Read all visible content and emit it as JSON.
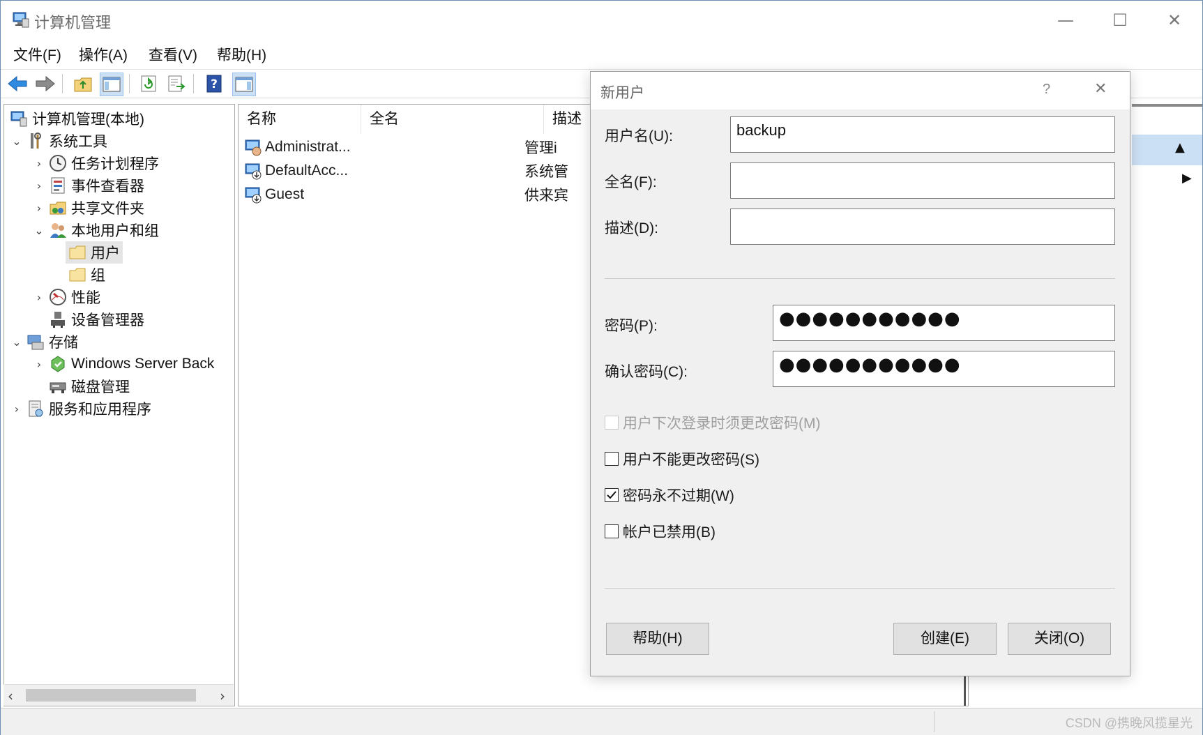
{
  "window": {
    "title": "计算机管理",
    "controls": {
      "minimize": "—",
      "maximize": "☐",
      "close": "✕"
    }
  },
  "menu": [
    "文件(F)",
    "操作(A)",
    "查看(V)",
    "帮助(H)"
  ],
  "toolbar": {
    "buttons": [
      "back-icon",
      "forward-icon",
      "up-folder-icon",
      "show-hide-tree-icon",
      "refresh-icon",
      "export-list-icon",
      "help-icon",
      "properties-pane-icon"
    ]
  },
  "tree": {
    "items": [
      {
        "label": "计算机管理(本地)",
        "icon": "computer-management-icon"
      },
      {
        "label": "系统工具",
        "arrow": "⌄",
        "icon": "tools-icon"
      },
      {
        "label": "任务计划程序",
        "arrow": "›",
        "icon": "clock-icon"
      },
      {
        "label": "事件查看器",
        "arrow": "›",
        "icon": "event-viewer-icon"
      },
      {
        "label": "共享文件夹",
        "arrow": "›",
        "icon": "shared-folder-icon"
      },
      {
        "label": "本地用户和组",
        "arrow": "⌄",
        "icon": "users-groups-icon"
      },
      {
        "label": "用户",
        "icon": "folder-icon"
      },
      {
        "label": "组",
        "icon": "folder-icon"
      },
      {
        "label": "性能",
        "arrow": "›",
        "icon": "performance-icon"
      },
      {
        "label": "设备管理器",
        "icon": "device-manager-icon"
      },
      {
        "label": "存储",
        "arrow": "⌄",
        "icon": "storage-icon"
      },
      {
        "label": "Windows Server Back",
        "arrow": "›",
        "icon": "backup-icon"
      },
      {
        "label": "磁盘管理",
        "icon": "disk-icon"
      },
      {
        "label": "服务和应用程序",
        "arrow": "›",
        "icon": "services-icon"
      }
    ],
    "scroll_left": "‹",
    "scroll_right": "›"
  },
  "list": {
    "columns": [
      "名称",
      "全名",
      "描述"
    ],
    "rows": [
      {
        "name": "Administrat...",
        "desc": "管理i"
      },
      {
        "name": "DefaultAcc...",
        "desc": "系统管"
      },
      {
        "name": "Guest",
        "desc": "供来宾"
      }
    ]
  },
  "dialog": {
    "title": "新用户",
    "help_glyph": "?",
    "close_glyph": "✕",
    "username_label": "用户名(U):",
    "username_value": "backup",
    "fullname_label": "全名(F):",
    "fullname_value": "",
    "description_label": "描述(D):",
    "description_value": "",
    "password_label": "密码(P):",
    "password_value": "●●●●●●●●●●●",
    "confirm_label": "确认密码(C):",
    "confirm_value": "●●●●●●●●●●●",
    "checkboxes": [
      {
        "label": "用户下次登录时须更改密码(M)",
        "checked": false,
        "disabled": true
      },
      {
        "label": "用户不能更改密码(S)",
        "checked": false,
        "disabled": false
      },
      {
        "label": "密码永不过期(W)",
        "checked": true,
        "disabled": false
      },
      {
        "label": "帐户已禁用(B)",
        "checked": false,
        "disabled": false
      }
    ],
    "help_button": "帮助(H)",
    "create_button": "创建(E)",
    "close_button": "关闭(O)"
  },
  "watermark": "CSDN @携晚风揽星光",
  "colors": {
    "accent": "#cce0f5",
    "frame": "#6b8fb5"
  }
}
